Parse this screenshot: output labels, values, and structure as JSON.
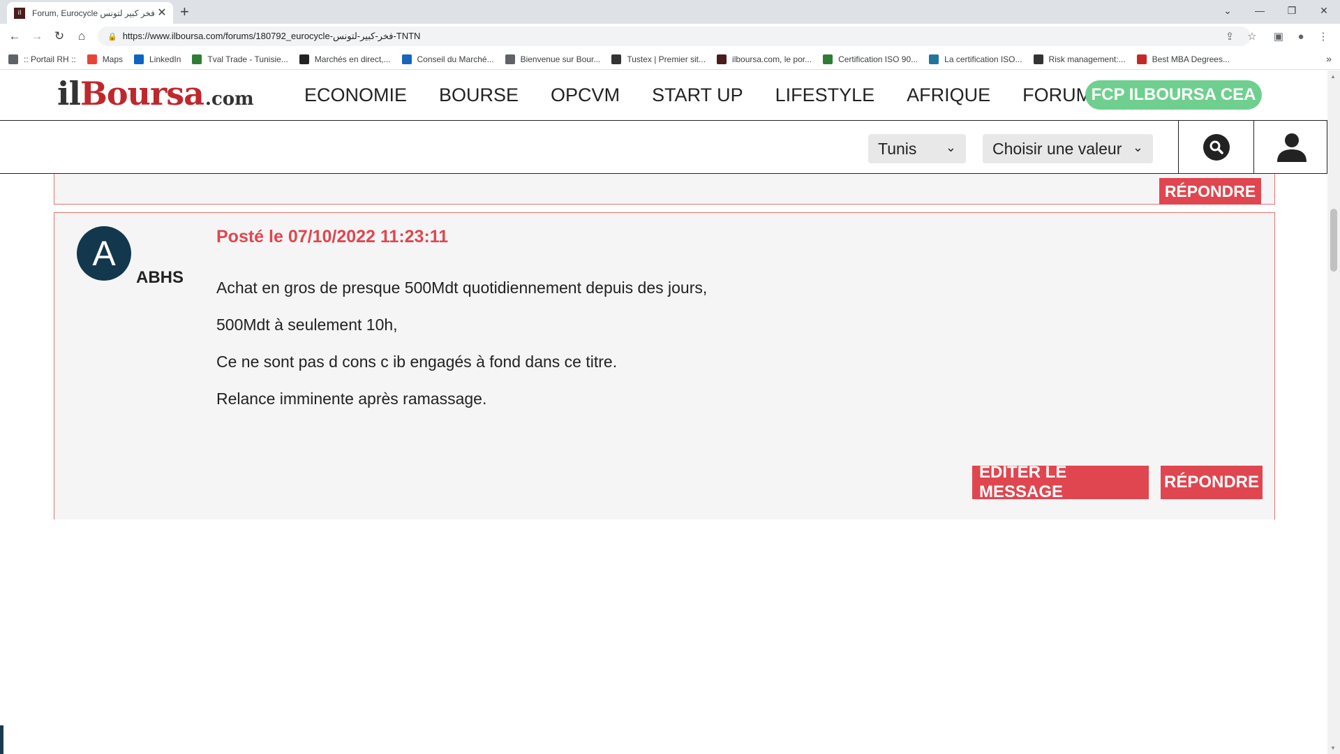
{
  "browser": {
    "tab_title": "Forum, Eurocycle فخر كبير لتونس",
    "tab_close": "✕",
    "new_tab": "+",
    "url": "https://www.ilboursa.com/forums/180792_eurocycle-فخر-كبير-لتونس-TNTN",
    "bookmarks": [
      {
        "label": ":: Portail RH ::",
        "icon": "globe-icon",
        "color": "#5f6368"
      },
      {
        "label": "Maps",
        "icon": "maps-pin-icon",
        "color": "#ea4335"
      },
      {
        "label": "LinkedIn",
        "icon": "linkedin-icon",
        "color": "#0a66c2"
      },
      {
        "label": "Tval Trade - Tunisie...",
        "icon": "tval-icon",
        "color": "#2e7d32"
      },
      {
        "label": "Marchés en direct,...",
        "icon": "investing-icon",
        "color": "#222222"
      },
      {
        "label": "Conseil du Marché...",
        "icon": "triangle-icon",
        "color": "#1565c0"
      },
      {
        "label": "Bienvenue sur Bour...",
        "icon": "globe-icon",
        "color": "#5f6368"
      },
      {
        "label": "Tustex | Premier sit...",
        "icon": "tustex-icon",
        "color": "#333333"
      },
      {
        "label": "ilboursa.com, le por...",
        "icon": "ilboursa-icon",
        "color": "#4a1c1c"
      },
      {
        "label": "Certification ISO 90...",
        "icon": "play-icon",
        "color": "#2e7d32"
      },
      {
        "label": "La certification ISO...",
        "icon": "wordpress-icon",
        "color": "#21759b"
      },
      {
        "label": "Risk management:...",
        "icon": "qr-icon",
        "color": "#333333"
      },
      {
        "label": "Best MBA Degrees...",
        "icon": "shield-icon",
        "color": "#c62828"
      }
    ],
    "bookmarks_more": "»"
  },
  "site": {
    "logo": {
      "part1": "il",
      "part2": "Boursa",
      "part3": ".com"
    },
    "nav": [
      "ECONOMIE",
      "BOURSE",
      "OPCVM",
      "START UP",
      "LIFESTYLE",
      "AFRIQUE",
      "FORUM"
    ],
    "cta": "FCP ILBOURSA CEA",
    "market_select": "Tunis",
    "value_select": "Choisir une valeur"
  },
  "prev_post": {
    "reply_label": "RÉPONDRE"
  },
  "post": {
    "avatar_letter": "A",
    "username": "ABHS",
    "posted": "Posté le 07/10/2022 11:23:11",
    "paragraphs": [
      "Achat en gros de presque 500Mdt quotidiennement depuis des jours,",
      "500Mdt à seulement 10h,",
      "Ce ne sont pas d cons c ib engagés à fond dans ce titre.",
      "Relance imminente après ramassage."
    ],
    "edit_label": "EDITER LE MESSAGE",
    "reply_label": "RÉPONDRE"
  },
  "colors": {
    "accent_red": "#e0464f",
    "cta_green": "#6fcf8f",
    "avatar_bg": "#13374d"
  }
}
